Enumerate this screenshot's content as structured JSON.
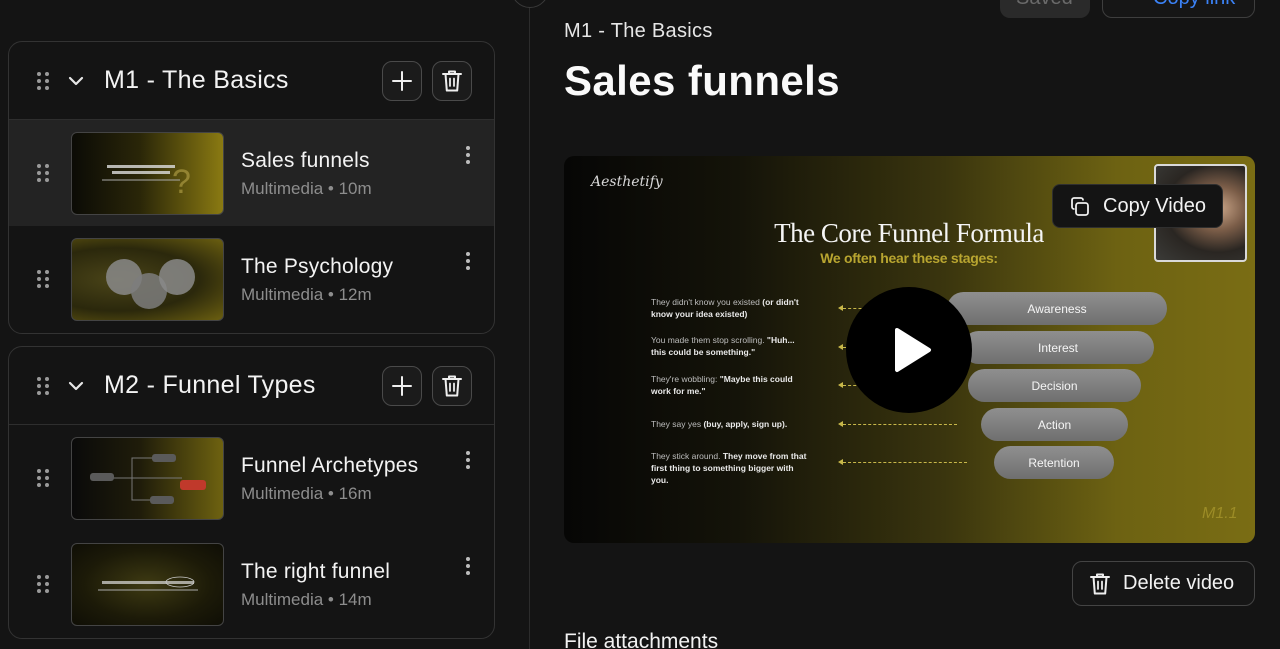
{
  "header": {
    "saved_label": "Saved",
    "copy_link_label": "Copy link"
  },
  "breadcrumb": "M1 - The Basics",
  "page_title": "Sales funnels",
  "modules": [
    {
      "title": "M1 - The Basics",
      "lessons": [
        {
          "title": "Sales funnels",
          "meta": "Multimedia • 10m",
          "active": true
        },
        {
          "title": "The Psychology",
          "meta": "Multimedia • 12m",
          "active": false
        }
      ]
    },
    {
      "title": "M2 - Funnel Types",
      "lessons": [
        {
          "title": "Funnel Archetypes",
          "meta": "Multimedia • 16m",
          "active": false
        },
        {
          "title": "The right funnel",
          "meta": "Multimedia • 14m",
          "active": false
        }
      ]
    }
  ],
  "video": {
    "brand": "Aesthetify",
    "heading": "The Core Funnel Formula",
    "subheading": "We often hear these stages:",
    "stages": [
      {
        "label": "Awareness",
        "desc_plain": "They didn't know you existed ",
        "desc_bold": "(or didn't know your idea existed)"
      },
      {
        "label": "Interest",
        "desc_plain": "You made them stop scrolling. ",
        "desc_bold": "\"Huh... this could be something.\""
      },
      {
        "label": "Decision",
        "desc_plain": "They're wobbling: ",
        "desc_bold": "\"Maybe this could work for me.\""
      },
      {
        "label": "Action",
        "desc_plain": "They say yes ",
        "desc_bold": "(buy, apply, sign up)."
      },
      {
        "label": "Retention",
        "desc_plain": "They stick around. ",
        "desc_bold": "They move from that first thing to something bigger with you."
      }
    ],
    "tag": "M1.1",
    "copy_video_label": "Copy Video"
  },
  "delete_video_label": "Delete video",
  "attachments_heading": "File attachments",
  "colors": {
    "link_blue": "#3b82f6",
    "video_gold": "#7a6d14"
  },
  "icons": [
    "drag-handle-icon",
    "chevron-down-icon",
    "plus-icon",
    "trash-icon",
    "kebab-icon",
    "play-icon",
    "copy-icon"
  ]
}
